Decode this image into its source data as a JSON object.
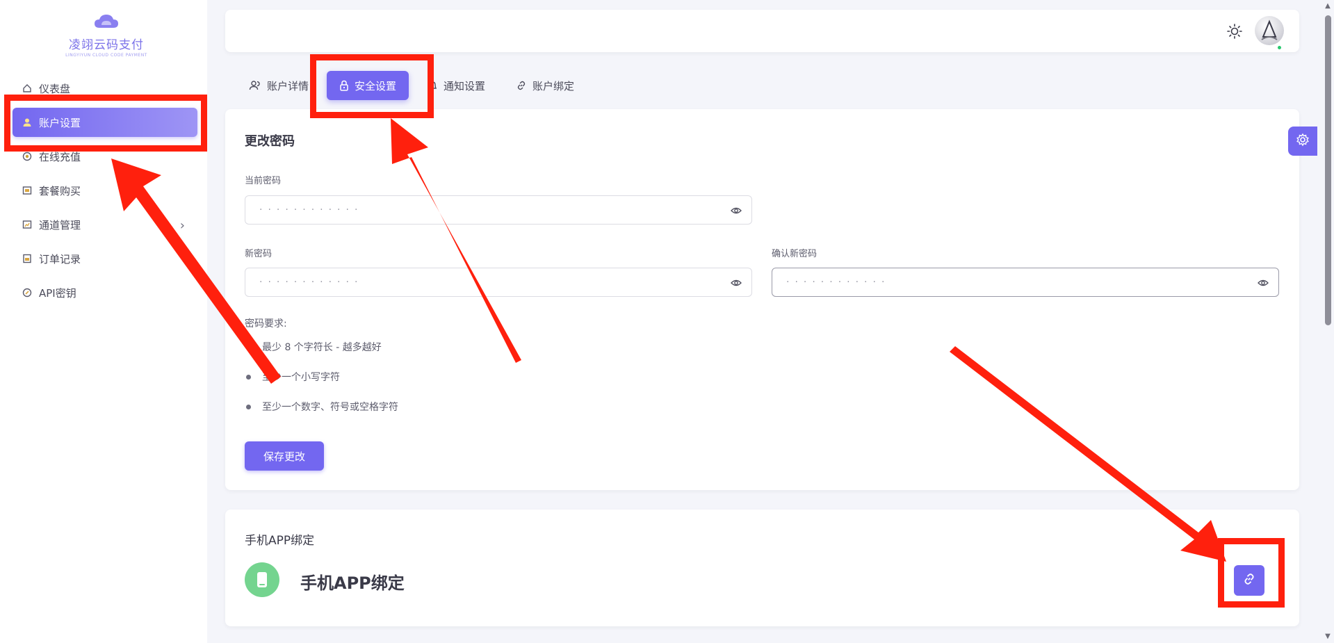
{
  "brand": {
    "name": "凌翊云码支付",
    "subtitle": "LINGYIYUN CLOUD CODE PAYMENT"
  },
  "sidebar": {
    "items": [
      {
        "label": "仪表盘",
        "icon": "home-icon"
      },
      {
        "label": "账户设置",
        "icon": "user-icon"
      },
      {
        "label": "在线充值",
        "icon": "coin-icon"
      },
      {
        "label": "套餐购买",
        "icon": "package-icon"
      },
      {
        "label": "通道管理",
        "icon": "chart-icon"
      },
      {
        "label": "订单记录",
        "icon": "order-icon"
      },
      {
        "label": "API密钥",
        "icon": "key-icon"
      }
    ]
  },
  "tabs": [
    {
      "label": "账户详情",
      "icon": "users-icon"
    },
    {
      "label": "安全设置",
      "icon": "lock-icon"
    },
    {
      "label": "通知设置",
      "icon": "bell-icon"
    },
    {
      "label": "账户绑定",
      "icon": "link-icon"
    }
  ],
  "password_card": {
    "title": "更改密码",
    "current_label": "当前密码",
    "new_label": "新密码",
    "confirm_label": "确认新密码",
    "current_value": "············",
    "new_value": "············",
    "confirm_value": "············",
    "requirements_title": "密码要求:",
    "requirements": [
      "最少 8 个字符长 - 越多越好",
      "至少一个小写字符",
      "至少一个数字、符号或空格字符"
    ],
    "save_label": "保存更改"
  },
  "app_card": {
    "title": "手机APP绑定",
    "item_name": "手机APP绑定"
  },
  "colors": {
    "primary": "#7367f0",
    "annotation": "#ff200d",
    "success": "#28c76f",
    "app_icon": "#74d48f"
  }
}
